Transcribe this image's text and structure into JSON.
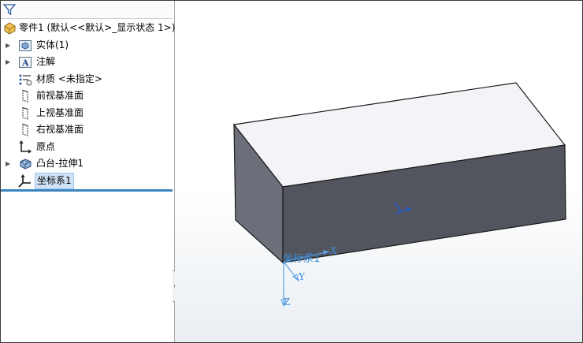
{
  "tree": {
    "root_label": "零件1  (默认<<默认>_显示状态 1>)",
    "items": [
      {
        "label": "实体(1)",
        "icon": "solid-bodies-folder-icon",
        "expandable": true
      },
      {
        "label": "注解",
        "icon": "annotations-icon",
        "expandable": true
      },
      {
        "label": "材质 <未指定>",
        "icon": "material-icon",
        "expandable": false
      },
      {
        "label": "前视基准面",
        "icon": "plane-icon",
        "expandable": false
      },
      {
        "label": "上视基准面",
        "icon": "plane-icon",
        "expandable": false
      },
      {
        "label": "右视基准面",
        "icon": "plane-icon",
        "expandable": false
      },
      {
        "label": "原点",
        "icon": "origin-icon",
        "expandable": false
      },
      {
        "label": "凸台-拉伸1",
        "icon": "boss-extrude-icon",
        "expandable": true
      },
      {
        "label": "坐标系1",
        "icon": "coordinate-system-icon",
        "expandable": false,
        "selected": true
      }
    ]
  },
  "viewport": {
    "coordinate_system_label": "坐标系1",
    "axes": {
      "x": "X",
      "y": "Y",
      "z": "Z"
    },
    "colors": {
      "body_front": "#52545e",
      "body_top": "#f2f2f6",
      "body_side": "#6b6d78",
      "accent": "#3c8cd8"
    }
  }
}
